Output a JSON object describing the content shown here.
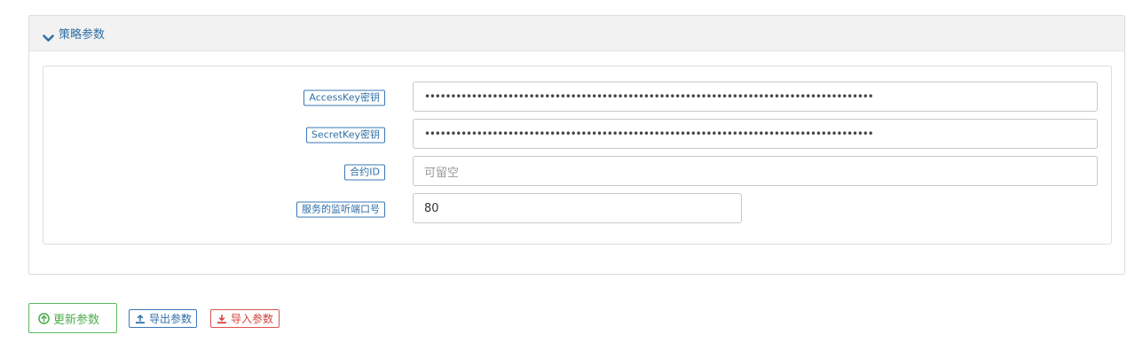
{
  "panel": {
    "title": "策略参数",
    "expand_icon": "chevron-down-icon"
  },
  "params": [
    {
      "label": "AccessKey密钥",
      "value": "••••••••••••••••••••••••••••••••••••••••••••••••••••••••••••••••••••••••••••••••••••••",
      "placeholder": "",
      "type": "password"
    },
    {
      "label": "SecretKey密钥",
      "value": "••••••••••••••••••••••••••••••••••••••••••••••••••••••••••••••••••••••••••••••••••••••",
      "placeholder": "",
      "type": "password"
    },
    {
      "label": "合约ID",
      "value": "",
      "placeholder": "可留空",
      "type": "text"
    },
    {
      "label": "服务的监听端口号",
      "value": "80",
      "placeholder": "",
      "type": "number"
    }
  ],
  "actions": {
    "update_label": "更新参数",
    "export_label": "导出参数",
    "import_label": "导入参数"
  },
  "colors": {
    "primary": "#2f6fa5",
    "success": "#4cae4c",
    "danger": "#d43f3a"
  }
}
